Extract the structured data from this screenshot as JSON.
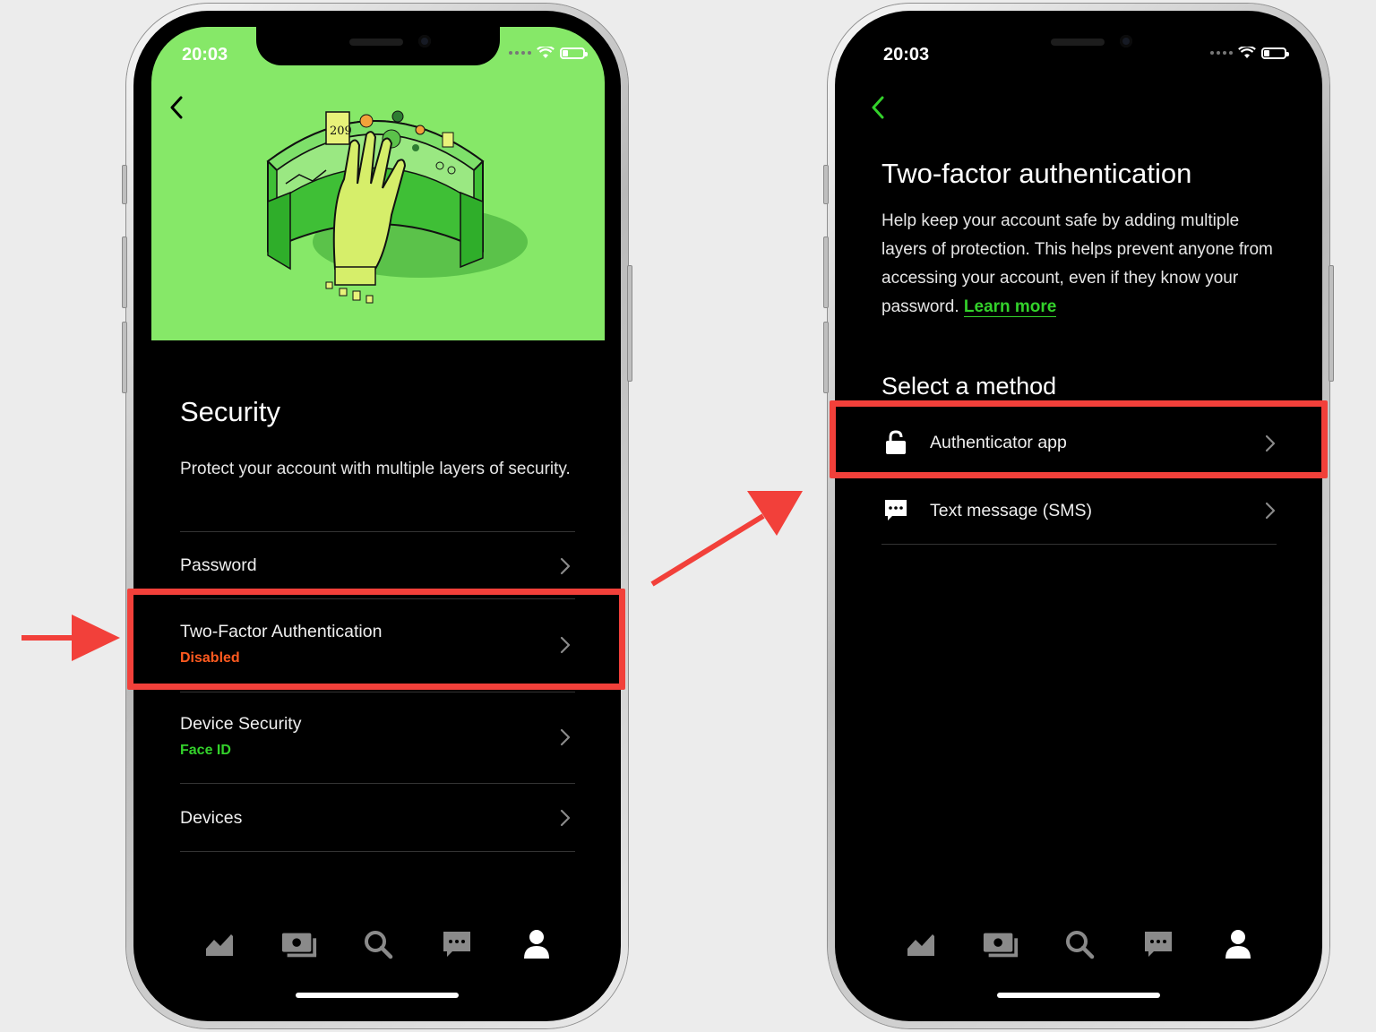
{
  "colors": {
    "accent_green": "#33d12b",
    "disabled_red": "#ff5a1f",
    "hero_green": "#86e868",
    "highlight_red": "#f2403a"
  },
  "left_screen": {
    "status_time": "20:03",
    "back_icon": "chevron-left-icon",
    "hero_illustration": "hand-scanner-illustration",
    "illustration_text": "209",
    "title": "Security",
    "description": "Protect your account with multiple layers of security.",
    "rows": [
      {
        "label": "Password",
        "sub": ""
      },
      {
        "label": "Two-Factor Authentication",
        "sub": "Disabled"
      },
      {
        "label": "Device Security",
        "sub": "Face ID"
      },
      {
        "label": "Devices",
        "sub": ""
      }
    ],
    "tabs": [
      "chart-icon",
      "cash-icon",
      "search-icon",
      "messages-icon",
      "account-icon"
    ]
  },
  "right_screen": {
    "status_time": "20:03",
    "back_icon": "chevron-left-icon",
    "title": "Two-factor authentication",
    "description": "Help keep your account safe by adding multiple layers of protection. This helps prevent anyone from accessing your account, even if they know your password.",
    "learn_more": "Learn more",
    "section_title": "Select a method",
    "methods": [
      {
        "icon": "lock-icon",
        "label": "Authenticator app"
      },
      {
        "icon": "message-icon",
        "label": "Text message (SMS)"
      }
    ],
    "tabs": [
      "chart-icon",
      "cash-icon",
      "search-icon",
      "messages-icon",
      "account-icon"
    ]
  }
}
